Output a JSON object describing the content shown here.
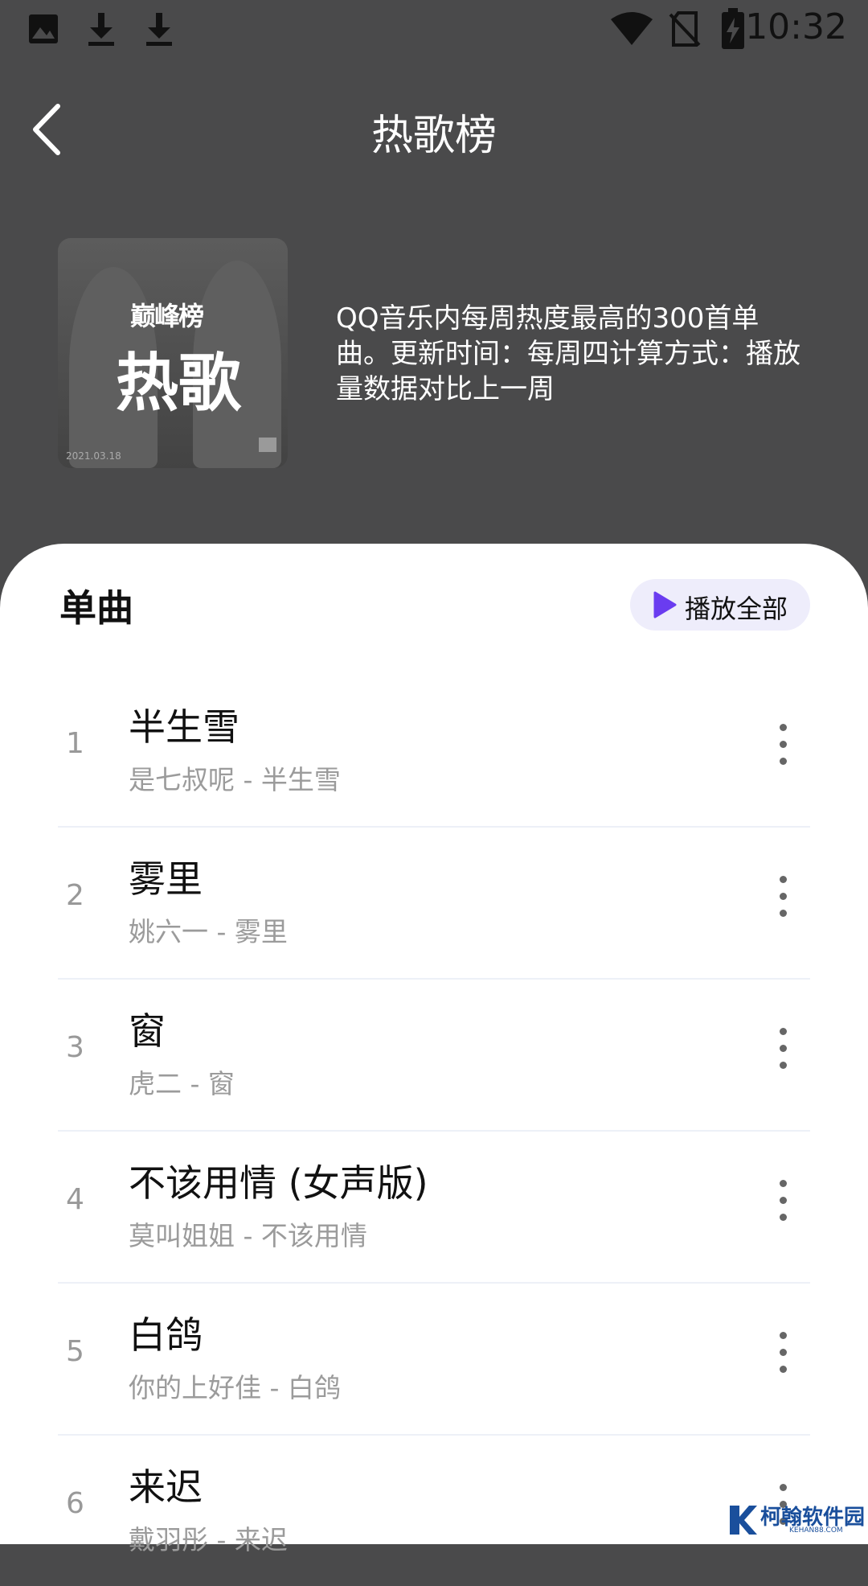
{
  "status_bar": {
    "time": "10:32"
  },
  "header": {
    "title": "热歌榜"
  },
  "chart_info": {
    "cover": {
      "logo_text": "巅峰榜",
      "title": "热歌",
      "date": "2021.03.18"
    },
    "description": "QQ音乐内每周热度最高的300首单曲。更新时间：每周四计算方式：播放量数据对比上一周"
  },
  "section": {
    "title": "单曲",
    "play_all_label": "播放全部"
  },
  "songs": [
    {
      "rank": "1",
      "title": "半生雪",
      "subtitle": "是七叔呢 - 半生雪"
    },
    {
      "rank": "2",
      "title": "雾里",
      "subtitle": "姚六一 - 雾里"
    },
    {
      "rank": "3",
      "title": "窗",
      "subtitle": "虎二 - 窗"
    },
    {
      "rank": "4",
      "title": "不该用情 (女声版)",
      "subtitle": "莫叫姐姐 - 不该用情"
    },
    {
      "rank": "5",
      "title": "白鸽",
      "subtitle": "你的上好佳 - 白鸽"
    },
    {
      "rank": "6",
      "title": "来迟",
      "subtitle": "戴羽彤 - 来迟"
    }
  ],
  "watermark": {
    "text": "柯翰软件园",
    "sub": "KEHAN88.COM"
  },
  "colors": {
    "accent": "#6a3cf0",
    "sheet": "#ffffff",
    "header_bg": "#4a4a4b"
  }
}
